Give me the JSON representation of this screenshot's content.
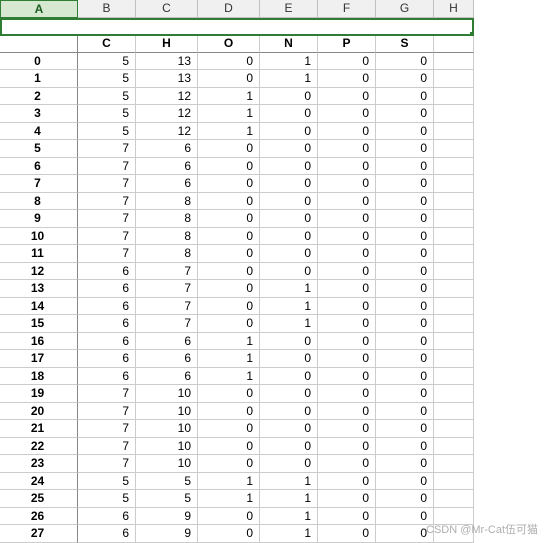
{
  "columns": [
    "A",
    "B",
    "C",
    "D",
    "E",
    "F",
    "G",
    "H"
  ],
  "selected_column": "A",
  "headers": [
    "",
    "C",
    "H",
    "O",
    "N",
    "P",
    "S",
    ""
  ],
  "index": [
    "0",
    "1",
    "2",
    "3",
    "4",
    "5",
    "6",
    "7",
    "8",
    "9",
    "10",
    "11",
    "12",
    "13",
    "14",
    "15",
    "16",
    "17",
    "18",
    "19",
    "20",
    "21",
    "22",
    "23",
    "24",
    "25",
    "26",
    "27"
  ],
  "rows": [
    [
      5,
      13,
      0,
      1,
      0,
      0
    ],
    [
      5,
      13,
      0,
      1,
      0,
      0
    ],
    [
      5,
      12,
      1,
      0,
      0,
      0
    ],
    [
      5,
      12,
      1,
      0,
      0,
      0
    ],
    [
      5,
      12,
      1,
      0,
      0,
      0
    ],
    [
      7,
      6,
      0,
      0,
      0,
      0
    ],
    [
      7,
      6,
      0,
      0,
      0,
      0
    ],
    [
      7,
      6,
      0,
      0,
      0,
      0
    ],
    [
      7,
      8,
      0,
      0,
      0,
      0
    ],
    [
      7,
      8,
      0,
      0,
      0,
      0
    ],
    [
      7,
      8,
      0,
      0,
      0,
      0
    ],
    [
      7,
      8,
      0,
      0,
      0,
      0
    ],
    [
      6,
      7,
      0,
      0,
      0,
      0
    ],
    [
      6,
      7,
      0,
      1,
      0,
      0
    ],
    [
      6,
      7,
      0,
      1,
      0,
      0
    ],
    [
      6,
      7,
      0,
      1,
      0,
      0
    ],
    [
      6,
      6,
      1,
      0,
      0,
      0
    ],
    [
      6,
      6,
      1,
      0,
      0,
      0
    ],
    [
      6,
      6,
      1,
      0,
      0,
      0
    ],
    [
      7,
      10,
      0,
      0,
      0,
      0
    ],
    [
      7,
      10,
      0,
      0,
      0,
      0
    ],
    [
      7,
      10,
      0,
      0,
      0,
      0
    ],
    [
      7,
      10,
      0,
      0,
      0,
      0
    ],
    [
      7,
      10,
      0,
      0,
      0,
      0
    ],
    [
      5,
      5,
      1,
      1,
      0,
      0
    ],
    [
      5,
      5,
      1,
      1,
      0,
      0
    ],
    [
      6,
      9,
      0,
      1,
      0,
      0
    ],
    [
      6,
      9,
      0,
      1,
      0,
      0
    ]
  ],
  "watermark": "CSDN @Mr-Cat伍可猫",
  "chart_data": {
    "type": "table",
    "columns": [
      "C",
      "H",
      "O",
      "N",
      "P",
      "S"
    ],
    "index": [
      0,
      1,
      2,
      3,
      4,
      5,
      6,
      7,
      8,
      9,
      10,
      11,
      12,
      13,
      14,
      15,
      16,
      17,
      18,
      19,
      20,
      21,
      22,
      23,
      24,
      25,
      26,
      27
    ],
    "data": [
      [
        5,
        13,
        0,
        1,
        0,
        0
      ],
      [
        5,
        13,
        0,
        1,
        0,
        0
      ],
      [
        5,
        12,
        1,
        0,
        0,
        0
      ],
      [
        5,
        12,
        1,
        0,
        0,
        0
      ],
      [
        5,
        12,
        1,
        0,
        0,
        0
      ],
      [
        7,
        6,
        0,
        0,
        0,
        0
      ],
      [
        7,
        6,
        0,
        0,
        0,
        0
      ],
      [
        7,
        6,
        0,
        0,
        0,
        0
      ],
      [
        7,
        8,
        0,
        0,
        0,
        0
      ],
      [
        7,
        8,
        0,
        0,
        0,
        0
      ],
      [
        7,
        8,
        0,
        0,
        0,
        0
      ],
      [
        7,
        8,
        0,
        0,
        0,
        0
      ],
      [
        6,
        7,
        0,
        0,
        0,
        0
      ],
      [
        6,
        7,
        0,
        1,
        0,
        0
      ],
      [
        6,
        7,
        0,
        1,
        0,
        0
      ],
      [
        6,
        7,
        0,
        1,
        0,
        0
      ],
      [
        6,
        6,
        1,
        0,
        0,
        0
      ],
      [
        6,
        6,
        1,
        0,
        0,
        0
      ],
      [
        6,
        6,
        1,
        0,
        0,
        0
      ],
      [
        7,
        10,
        0,
        0,
        0,
        0
      ],
      [
        7,
        10,
        0,
        0,
        0,
        0
      ],
      [
        7,
        10,
        0,
        0,
        0,
        0
      ],
      [
        7,
        10,
        0,
        0,
        0,
        0
      ],
      [
        7,
        10,
        0,
        0,
        0,
        0
      ],
      [
        5,
        5,
        1,
        1,
        0,
        0
      ],
      [
        5,
        5,
        1,
        1,
        0,
        0
      ],
      [
        6,
        9,
        0,
        1,
        0,
        0
      ],
      [
        6,
        9,
        0,
        1,
        0,
        0
      ]
    ]
  }
}
